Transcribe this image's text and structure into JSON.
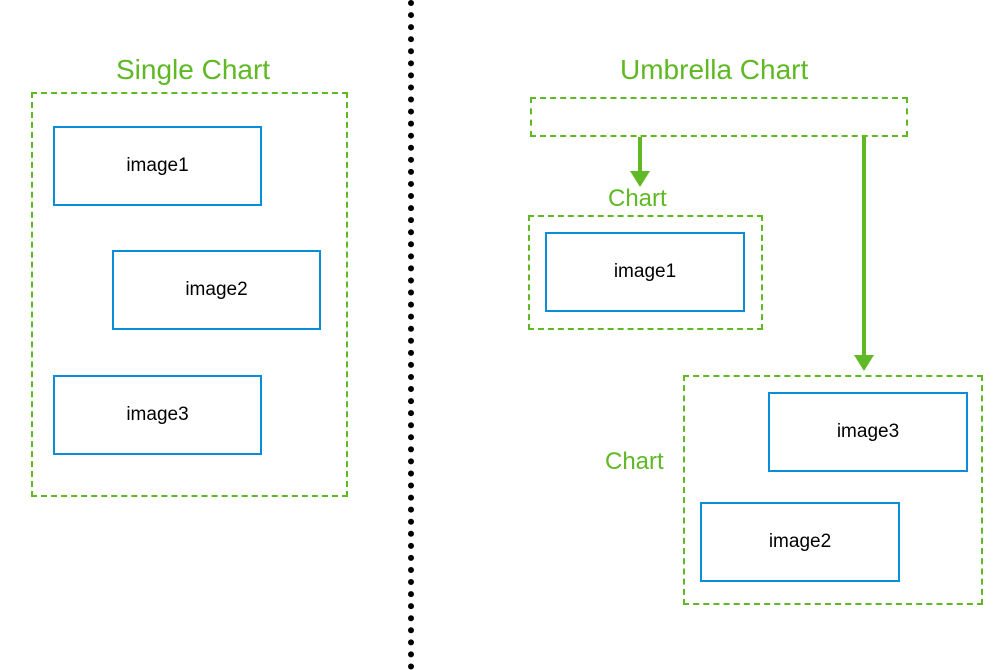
{
  "left": {
    "title": "Single Chart",
    "boxes": [
      "image1",
      "image2",
      "image3"
    ]
  },
  "right": {
    "title": "Umbrella Chart",
    "sub1": {
      "label": "Chart",
      "box": "image1"
    },
    "sub2": {
      "label": "Chart",
      "boxes": [
        "image3",
        "image2"
      ]
    }
  },
  "colors": {
    "green": "#5fb824",
    "blue": "#0a8dd8"
  }
}
